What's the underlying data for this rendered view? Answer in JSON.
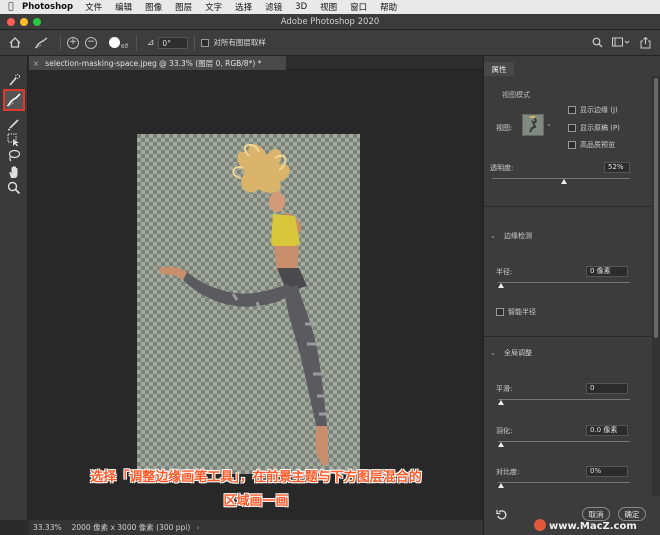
{
  "menubar": {
    "app": "Photoshop",
    "items": [
      "文件",
      "编辑",
      "图像",
      "图层",
      "文字",
      "选择",
      "滤镜",
      "3D",
      "视图",
      "窗口",
      "帮助"
    ]
  },
  "titlebar": {
    "title": "Adobe Photoshop 2020"
  },
  "options": {
    "brush_size": "60",
    "angle": "0°",
    "sample_all_label": "对所有图层取样"
  },
  "document": {
    "tab_title": "selection-masking-space.jpeg @ 33.3% (图层 0, RGB/8*) *",
    "tab_close": "×"
  },
  "caption": {
    "line1": "选择「调整边缘画笔工具」，在前景主题与下方图层混合的",
    "line2": "区域画一画"
  },
  "status": {
    "zoom": "33.33%",
    "info": "2000 像素 x 3000 像素 (300 ppi)",
    "arrow": "›"
  },
  "panel": {
    "tab": "属性",
    "view_mode": {
      "title": "视图模式",
      "view_label": "视图:",
      "show_edge": "显示边缘 (J)",
      "show_original": "显示原稿 (P)",
      "hq_preview": "高品质预览"
    },
    "opacity": {
      "label": "透明度:",
      "value": "52%",
      "level": 0.52
    },
    "edge_detection": {
      "title": "边缘检测",
      "radius_label": "半径:",
      "radius_value": "0 像素",
      "smart_radius": "智能半径"
    },
    "global": {
      "title": "全局调整",
      "smooth_label": "平滑:",
      "smooth_value": "0",
      "feather_label": "羽化:",
      "feather_value": "0.0 像素",
      "contrast_label": "对比度:",
      "contrast_value": "0%"
    },
    "cancel": "取消",
    "ok": "确定"
  },
  "watermark": "www.MacZ.com",
  "colors": {
    "highlight": "#e03a2d",
    "caption": "#ff5a2a"
  }
}
